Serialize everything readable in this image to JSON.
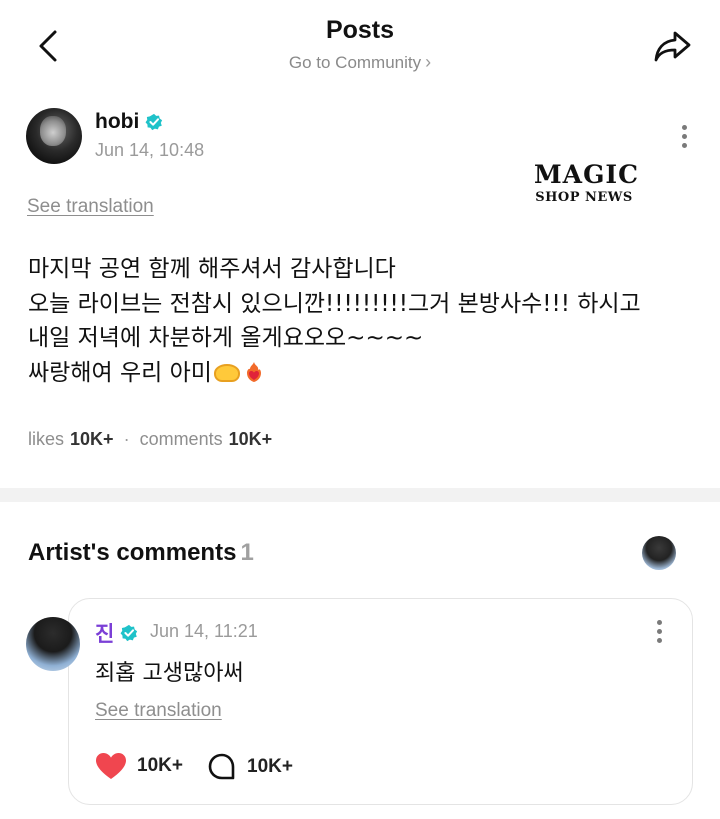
{
  "header": {
    "title": "Posts",
    "community_link": "Go to Community",
    "back_icon": "arrow-left-icon",
    "share_icon": "share-arrow-icon"
  },
  "post": {
    "author": "hobi",
    "time": "Jun 14, 10:48",
    "see_translation": "See translation",
    "lines": [
      "마지막 공연 함께 해주셔서 감사합니다",
      "오늘 라이브는 전참시 있으니깐!!!!!!!!!그거 본방사수!!! 하시고",
      "내일 저녁에 차분하게 올게요오오~~~~",
      "싸랑해여 우리 아미"
    ],
    "emojis": [
      "heart-hands-emoji",
      "heart-on-fire-emoji"
    ],
    "likes_label": "likes",
    "likes_count": "10K+",
    "comments_label": "comments",
    "comments_count": "10K+"
  },
  "watermark": {
    "top": "MAGIC",
    "bottom": "SHOP NEWS"
  },
  "artist_comments": {
    "title": "Artist's comments",
    "count": "1",
    "comment": {
      "author": "진",
      "time": "Jun 14, 11:21",
      "text": "죄홉 고생많아써",
      "see_translation": "See translation",
      "likes": "10K+",
      "replies": "10K+"
    }
  },
  "colors": {
    "verified": "#1fc2c9",
    "comment_author": "#7b3fd6",
    "like_heart": "#f0464f",
    "muted_text": "#8e8e8e"
  }
}
